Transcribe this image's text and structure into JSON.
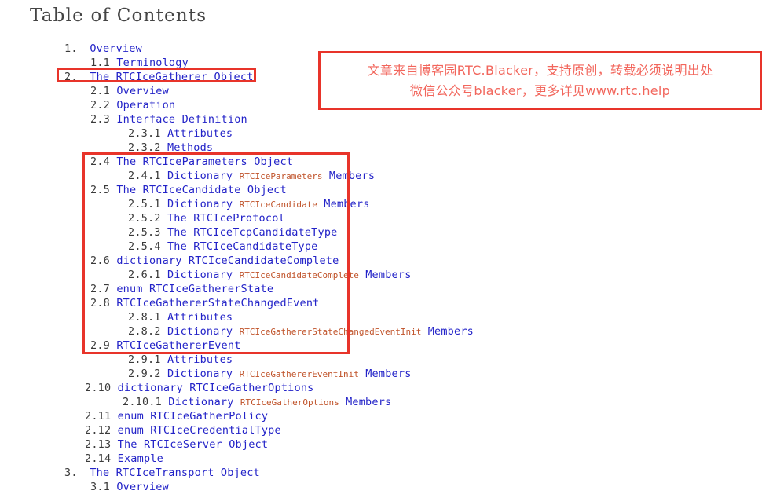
{
  "document": {
    "title": "Table of Contents"
  },
  "toc": {
    "items": [
      {
        "level": 1,
        "num": "1.",
        "text": "Overview",
        "code": "",
        "tail": ""
      },
      {
        "level": 2,
        "num": "1.1",
        "text": "Terminology",
        "code": "",
        "tail": ""
      },
      {
        "level": 1,
        "num": "2.",
        "text": "The RTCIceGatherer Object",
        "code": "",
        "tail": ""
      },
      {
        "level": 2,
        "num": "2.1",
        "text": "Overview",
        "code": "",
        "tail": ""
      },
      {
        "level": 2,
        "num": "2.2",
        "text": "Operation",
        "code": "",
        "tail": ""
      },
      {
        "level": 2,
        "num": "2.3",
        "text": "Interface Definition",
        "code": "",
        "tail": ""
      },
      {
        "level": 3,
        "num": "2.3.1",
        "text": "Attributes",
        "code": "",
        "tail": ""
      },
      {
        "level": 3,
        "num": "2.3.2",
        "text": "Methods",
        "code": "",
        "tail": ""
      },
      {
        "level": 2,
        "num": "2.4",
        "text": "The RTCIceParameters Object",
        "code": "",
        "tail": ""
      },
      {
        "level": 3,
        "num": "2.4.1",
        "text": "Dictionary ",
        "code": "RTCIceParameters",
        "tail": " Members"
      },
      {
        "level": 2,
        "num": "2.5",
        "text": "The RTCIceCandidate Object",
        "code": "",
        "tail": ""
      },
      {
        "level": 3,
        "num": "2.5.1",
        "text": "Dictionary ",
        "code": "RTCIceCandidate",
        "tail": " Members"
      },
      {
        "level": 3,
        "num": "2.5.2",
        "text": "The RTCIceProtocol",
        "code": "",
        "tail": ""
      },
      {
        "level": 3,
        "num": "2.5.3",
        "text": "The RTCIceTcpCandidateType",
        "code": "",
        "tail": ""
      },
      {
        "level": 3,
        "num": "2.5.4",
        "text": "The RTCIceCandidateType",
        "code": "",
        "tail": ""
      },
      {
        "level": 2,
        "num": "2.6",
        "text": "dictionary RTCIceCandidateComplete",
        "code": "",
        "tail": ""
      },
      {
        "level": 3,
        "num": "2.6.1",
        "text": "Dictionary ",
        "code": "RTCIceCandidateComplete",
        "tail": " Members"
      },
      {
        "level": 2,
        "num": "2.7",
        "text": "enum RTCIceGathererState",
        "code": "",
        "tail": ""
      },
      {
        "level": 2,
        "num": "2.8",
        "text": "RTCIceGathererStateChangedEvent",
        "code": "",
        "tail": ""
      },
      {
        "level": 3,
        "num": "2.8.1",
        "text": "Attributes",
        "code": "",
        "tail": ""
      },
      {
        "level": 3,
        "num": "2.8.2",
        "text": "Dictionary ",
        "code": "RTCIceGathererStateChangedEventInit",
        "tail": " Members"
      },
      {
        "level": 2,
        "num": "2.9",
        "text": "RTCIceGathererEvent",
        "code": "",
        "tail": ""
      },
      {
        "level": 3,
        "num": "2.9.1",
        "text": "Attributes",
        "code": "",
        "tail": ""
      },
      {
        "level": 3,
        "num": "2.9.2",
        "text": "Dictionary ",
        "code": "RTCIceGathererEventInit",
        "tail": " Members"
      },
      {
        "level": 2,
        "num": "2.10",
        "text": "dictionary RTCIceGatherOptions",
        "code": "",
        "tail": ""
      },
      {
        "level": 3,
        "num": "2.10.1",
        "text": "Dictionary ",
        "code": "RTCIceGatherOptions",
        "tail": " Members"
      },
      {
        "level": 2,
        "num": "2.11",
        "text": "enum RTCIceGatherPolicy",
        "code": "",
        "tail": ""
      },
      {
        "level": 2,
        "num": "2.12",
        "text": "enum RTCIceCredentialType",
        "code": "",
        "tail": ""
      },
      {
        "level": 2,
        "num": "2.13",
        "text": "The RTCIceServer Object",
        "code": "",
        "tail": ""
      },
      {
        "level": 2,
        "num": "2.14",
        "text": "Example",
        "code": "",
        "tail": ""
      },
      {
        "level": 1,
        "num": "3.",
        "text": "The RTCIceTransport Object",
        "code": "",
        "tail": ""
      },
      {
        "level": 2,
        "num": "3.1",
        "text": "Overview",
        "code": "",
        "tail": ""
      }
    ]
  },
  "annotations": {
    "box_color": "#e8342a",
    "highlight_boxes": [
      {
        "name": "gatherer-heading",
        "target": "2. The RTCIceGatherer Object"
      },
      {
        "name": "section-group",
        "target": "2.4 through 2.9"
      }
    ],
    "note": {
      "line1": "文章来自博客园RTC.Blacker，支持原创，转载必须说明出处",
      "line2": "微信公众号blacker，更多详见www.rtc.help",
      "text_color": "#f2665c"
    }
  }
}
